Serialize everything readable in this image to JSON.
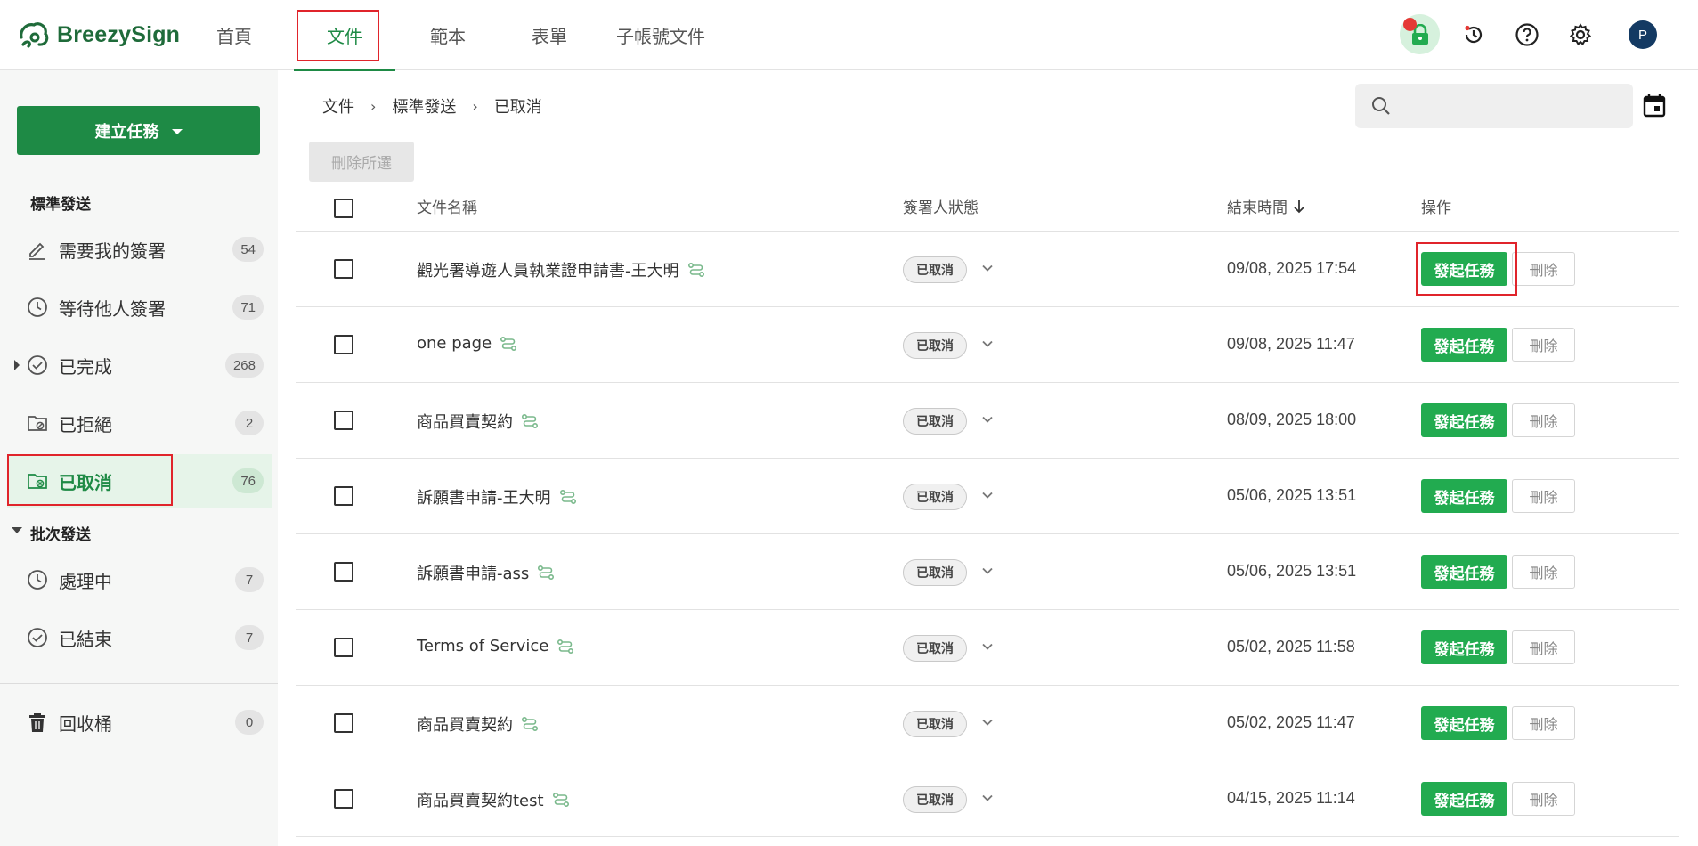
{
  "app": {
    "brand": "BreezySign"
  },
  "nav": [
    {
      "label": "首頁"
    },
    {
      "label": "文件"
    },
    {
      "label": "範本"
    },
    {
      "label": "表單"
    },
    {
      "label": "子帳號文件"
    }
  ],
  "header": {
    "avatar_initial": "P",
    "lock_badge": "!"
  },
  "sidebar": {
    "create_button": "建立任務",
    "section_standard": "標準發送",
    "section_batch": "批次發送",
    "standard_items": [
      {
        "label": "需要我的簽署",
        "count": "54"
      },
      {
        "label": "等待他人簽署",
        "count": "71"
      },
      {
        "label": "已完成",
        "count": "268"
      },
      {
        "label": "已拒絕",
        "count": "2"
      },
      {
        "label": "已取消",
        "count": "76"
      }
    ],
    "batch_items": [
      {
        "label": "處理中",
        "count": "7"
      },
      {
        "label": "已結束",
        "count": "7"
      }
    ],
    "trash": {
      "label": "回收桶",
      "count": "0"
    }
  },
  "breadcrumb": [
    "文件",
    "標準發送",
    "已取消"
  ],
  "toolbar": {
    "delete_selected": "刪除所選",
    "search_placeholder": ""
  },
  "table": {
    "headers": {
      "name": "文件名稱",
      "status": "簽署人狀態",
      "end_time": "結束時間",
      "actions": "操作"
    },
    "start_label": "發起任務",
    "delete_label": "刪除",
    "rows": [
      {
        "name": "觀光署導遊人員執業證申請書-王大明",
        "status": "已取消",
        "end_time": "09/08, 2025 17:54"
      },
      {
        "name": "one page",
        "status": "已取消",
        "end_time": "09/08, 2025 11:47"
      },
      {
        "name": "商品買賣契約",
        "status": "已取消",
        "end_time": "08/09, 2025 18:00"
      },
      {
        "name": "訴願書申請-王大明",
        "status": "已取消",
        "end_time": "05/06, 2025 13:51"
      },
      {
        "name": "訴願書申請-ass",
        "status": "已取消",
        "end_time": "05/06, 2025 13:51"
      },
      {
        "name": "Terms of Service",
        "status": "已取消",
        "end_time": "05/02, 2025 11:58"
      },
      {
        "name": "商品買賣契約",
        "status": "已取消",
        "end_time": "05/02, 2025 11:47"
      },
      {
        "name": "商品買賣契約test",
        "status": "已取消",
        "end_time": "04/15, 2025 11:14"
      }
    ]
  },
  "colors": {
    "brand_green": "#1e8a45",
    "action_green": "#22ab50",
    "highlight_red": "#e0242b"
  }
}
